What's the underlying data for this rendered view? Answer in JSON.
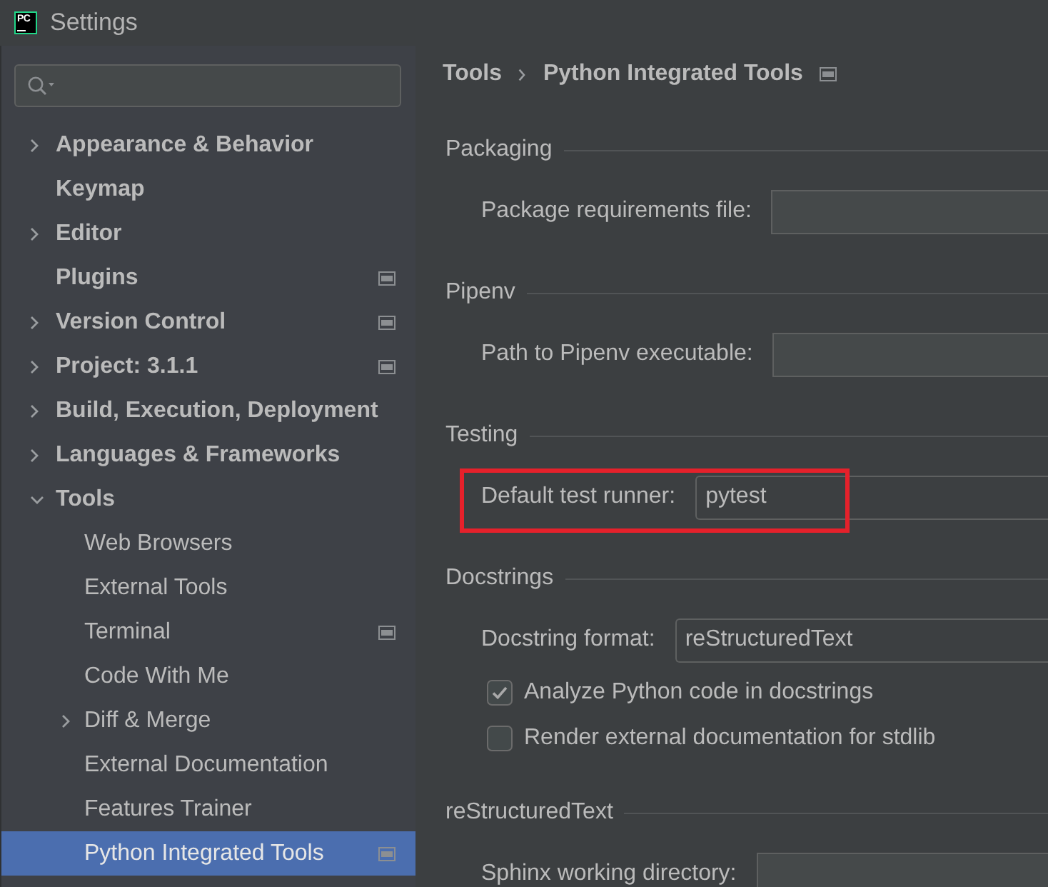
{
  "window": {
    "app_logo": "PC",
    "title": "Settings"
  },
  "sidebar": {
    "items": [
      {
        "label": "Appearance & Behavior",
        "expandable": true,
        "expanded": false,
        "project_level": false,
        "selected": false
      },
      {
        "label": "Keymap",
        "expandable": false,
        "expanded": false,
        "project_level": false,
        "selected": false
      },
      {
        "label": "Editor",
        "expandable": true,
        "expanded": false,
        "project_level": false,
        "selected": false
      },
      {
        "label": "Plugins",
        "expandable": false,
        "expanded": false,
        "project_level": true,
        "selected": false
      },
      {
        "label": "Version Control",
        "expandable": true,
        "expanded": false,
        "project_level": true,
        "selected": false
      },
      {
        "label": "Project: 3.1.1",
        "expandable": true,
        "expanded": false,
        "project_level": true,
        "selected": false
      },
      {
        "label": "Build, Execution, Deployment",
        "expandable": true,
        "expanded": false,
        "project_level": false,
        "selected": false
      },
      {
        "label": "Languages & Frameworks",
        "expandable": true,
        "expanded": false,
        "project_level": false,
        "selected": false
      },
      {
        "label": "Tools",
        "expandable": true,
        "expanded": true,
        "project_level": false,
        "selected": false,
        "children": [
          {
            "label": "Web Browsers",
            "expandable": false,
            "expanded": false,
            "project_level": false,
            "selected": false
          },
          {
            "label": "External Tools",
            "expandable": false,
            "expanded": false,
            "project_level": false,
            "selected": false
          },
          {
            "label": "Terminal",
            "expandable": false,
            "expanded": false,
            "project_level": true,
            "selected": false
          },
          {
            "label": "Code With Me",
            "expandable": false,
            "expanded": false,
            "project_level": false,
            "selected": false
          },
          {
            "label": "Diff & Merge",
            "expandable": true,
            "expanded": false,
            "project_level": false,
            "selected": false
          },
          {
            "label": "External Documentation",
            "expandable": false,
            "expanded": false,
            "project_level": false,
            "selected": false
          },
          {
            "label": "Features Trainer",
            "expandable": false,
            "expanded": false,
            "project_level": false,
            "selected": false
          },
          {
            "label": "Python Integrated Tools",
            "expandable": false,
            "expanded": false,
            "project_level": true,
            "selected": true
          }
        ]
      }
    ]
  },
  "content": {
    "breadcrumb": [
      "Tools",
      "Python Integrated Tools"
    ],
    "project_level": true,
    "sections": [
      {
        "title": "Packaging",
        "rows": [
          {
            "kind": "text",
            "label": "Package requirements file:",
            "highlighted": false
          }
        ]
      },
      {
        "title": "Pipenv",
        "rows": [
          {
            "kind": "text",
            "label": "Path to Pipenv executable:",
            "highlighted": false
          }
        ]
      },
      {
        "title": "Testing",
        "rows": [
          {
            "kind": "combo",
            "label": "Default test runner:",
            "value": "pytest",
            "highlighted": true
          }
        ]
      },
      {
        "title": "Docstrings",
        "rows": [
          {
            "kind": "combo",
            "label": "Docstring format:",
            "value": "reStructuredText",
            "highlighted": false
          },
          {
            "kind": "checkbox",
            "label": "Analyze Python code in docstrings",
            "checked": true,
            "highlighted": false
          },
          {
            "kind": "checkbox",
            "label": "Render external documentation for stdlib",
            "checked": false,
            "highlighted": false
          }
        ]
      },
      {
        "title": "reStructuredText",
        "rows": [
          {
            "kind": "text",
            "label": "Sphinx working directory:",
            "highlighted": false
          }
        ]
      }
    ]
  }
}
